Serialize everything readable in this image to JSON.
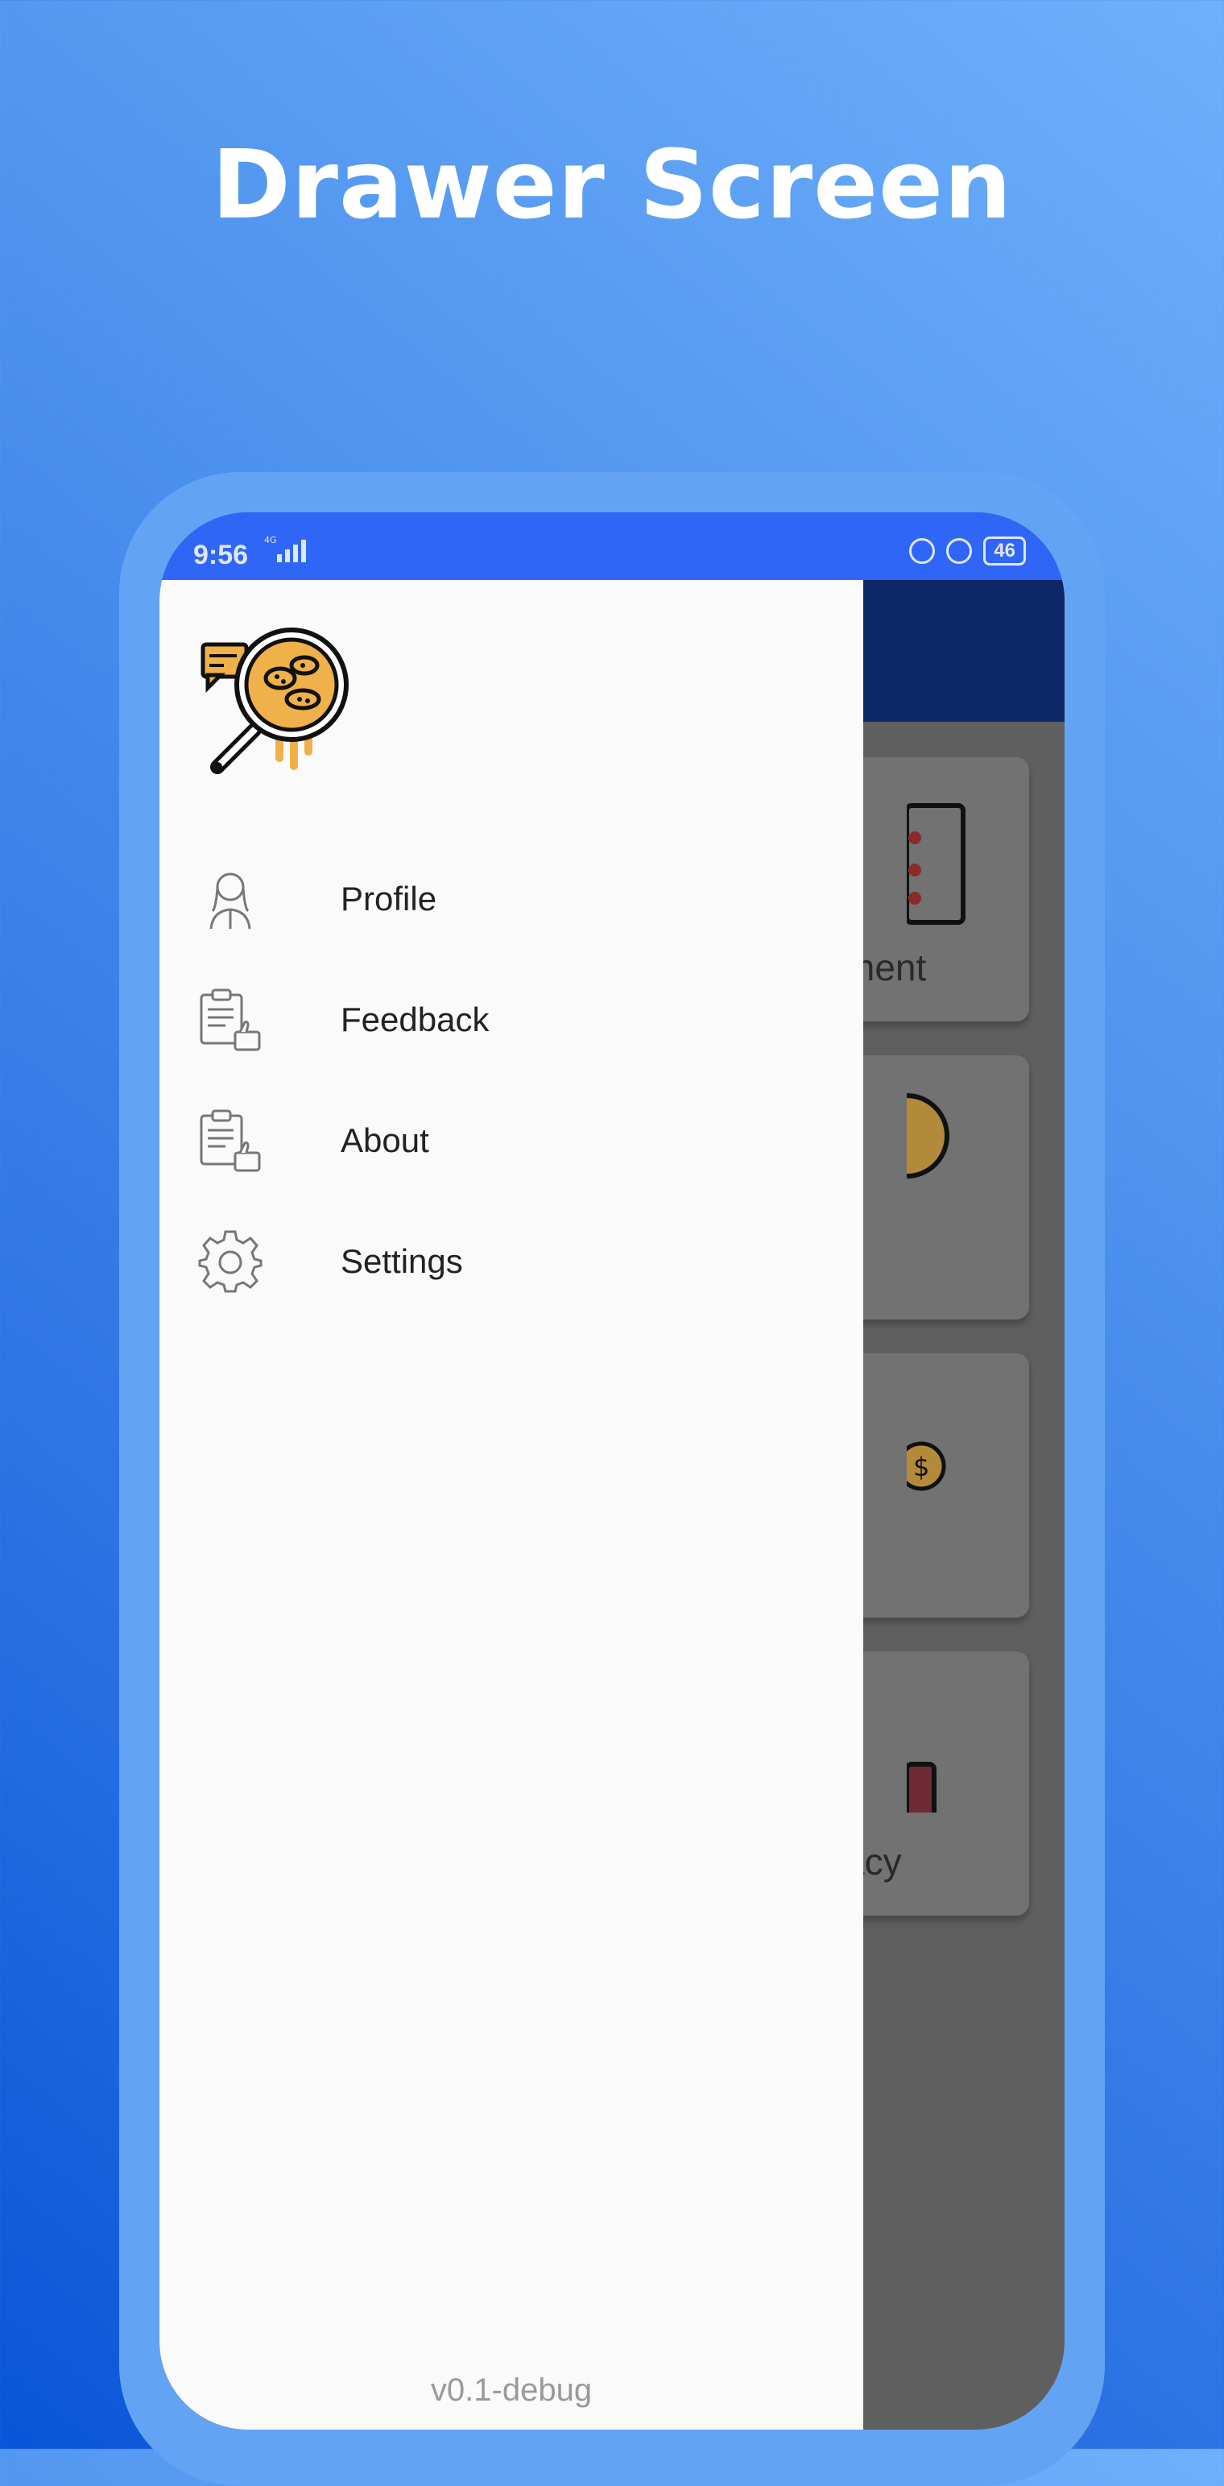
{
  "headline": "Drawer Screen",
  "status_bar": {
    "time": "9:56",
    "network": "4G",
    "battery": "46"
  },
  "drawer": {
    "menu": [
      {
        "label": "Profile",
        "icon": "person-icon"
      },
      {
        "label": "Feedback",
        "icon": "clipboard-thumbs-up-icon"
      },
      {
        "label": "About",
        "icon": "clipboard-thumbs-up-icon"
      },
      {
        "label": "Settings",
        "icon": "gear-icon"
      }
    ],
    "version": "v0.1-debug"
  },
  "background_cards": [
    {
      "partial_label": "ment"
    },
    {
      "partial_label": ""
    },
    {
      "partial_label": ""
    },
    {
      "partial_label": "acy"
    }
  ],
  "colors": {
    "status_bar": "#2f66f6",
    "app_bar_dimmed": "#0e2865",
    "drawer_bg": "#fafafa",
    "scrim": "#5f5f5f",
    "logo_accent": "#f0b04a"
  }
}
